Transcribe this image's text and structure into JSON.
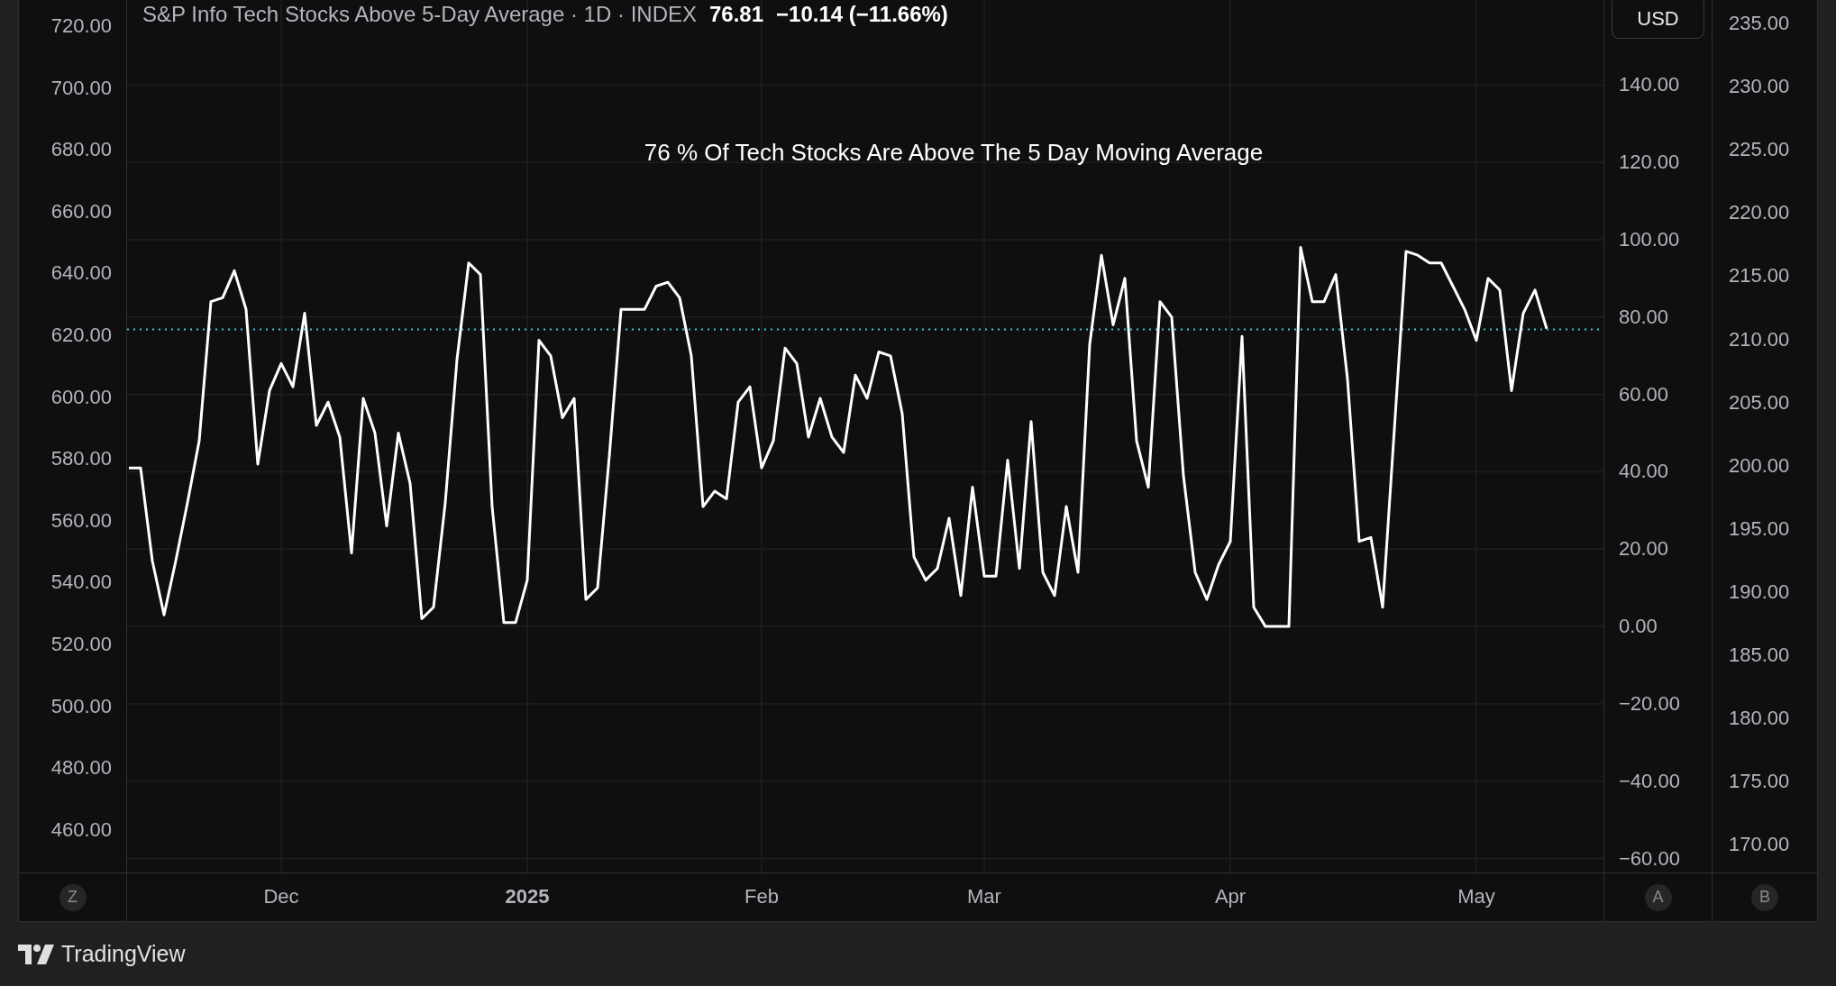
{
  "chart": {
    "header": {
      "title": "S&P Info Tech Stocks Above 5-Day Average · 1D · INDEX",
      "last": "76.81",
      "change": "−10.14 (−11.66%)"
    },
    "note": "76 % Of Tech Stocks Are Above The 5 Day Moving Average",
    "currency_button": "USD",
    "left_axis_labels": [
      "720.00",
      "700.00",
      "680.00",
      "660.00",
      "640.00",
      "620.00",
      "600.00",
      "580.00",
      "560.00",
      "540.00",
      "520.00",
      "500.00",
      "480.00",
      "460.00"
    ],
    "right_axis_labels": [
      "235.00",
      "230.00",
      "225.00",
      "220.00",
      "215.00",
      "210.00",
      "205.00",
      "200.00",
      "195.00",
      "190.00",
      "185.00",
      "180.00",
      "175.00",
      "170.00"
    ],
    "corner_buttons": [
      {
        "label": "Z"
      },
      {
        "label": "A"
      },
      {
        "label": "B"
      }
    ],
    "chart_data": {
      "type": "line",
      "ylim": [
        -63.6,
        162
      ],
      "yticks": [
        {
          "value": 140,
          "label": "140.00"
        },
        {
          "value": 120,
          "label": "120.00"
        },
        {
          "value": 100,
          "label": "100.00"
        },
        {
          "value": 80,
          "label": "80.00"
        },
        {
          "value": 60,
          "label": "60.00"
        },
        {
          "value": 40,
          "label": "40.00"
        },
        {
          "value": 20,
          "label": "20.00"
        },
        {
          "value": 0,
          "label": "0.00"
        },
        {
          "value": -20,
          "label": "−20.00"
        },
        {
          "value": -40,
          "label": "−40.00"
        },
        {
          "value": -60,
          "label": "−60.00"
        }
      ],
      "grid": true,
      "ref_lines": [
        {
          "axis": "y",
          "value": 76.81,
          "color": "#3fc8d8"
        }
      ],
      "categories": [
        null,
        null,
        null,
        null,
        null,
        null,
        null,
        null,
        null,
        null,
        null,
        null,
        null,
        "Dec",
        null,
        null,
        null,
        null,
        null,
        null,
        null,
        null,
        null,
        null,
        null,
        null,
        null,
        null,
        null,
        null,
        null,
        null,
        null,
        null,
        "2025",
        null,
        null,
        null,
        null,
        null,
        null,
        null,
        null,
        null,
        null,
        null,
        null,
        null,
        null,
        null,
        null,
        null,
        null,
        null,
        "Feb",
        null,
        null,
        null,
        null,
        null,
        null,
        null,
        null,
        null,
        null,
        null,
        null,
        null,
        null,
        null,
        null,
        null,
        null,
        "Mar",
        null,
        null,
        null,
        null,
        null,
        null,
        null,
        null,
        null,
        null,
        null,
        null,
        null,
        null,
        null,
        null,
        null,
        null,
        null,
        null,
        "Apr",
        null,
        null,
        null,
        null,
        null,
        null,
        null,
        null,
        null,
        null,
        null,
        null,
        null,
        null,
        null,
        null,
        null,
        null,
        null,
        null,
        "May",
        null,
        null,
        null,
        null,
        null,
        null
      ],
      "series": [
        {
          "color": "#ffffff",
          "values": [
            41,
            41,
            17,
            3,
            17,
            32,
            48,
            84,
            85,
            92,
            82,
            42,
            61,
            68,
            62,
            81,
            52,
            58,
            49,
            19,
            59,
            50,
            26,
            50,
            37,
            2,
            5,
            32,
            69,
            94,
            91,
            31,
            1,
            1,
            12,
            74,
            70,
            54,
            59,
            7,
            10,
            44,
            82,
            82,
            82,
            88,
            89,
            85,
            70,
            31,
            35,
            33,
            58,
            62,
            41,
            48,
            72,
            68,
            49,
            59,
            49,
            45,
            65,
            59,
            71,
            70,
            55,
            18,
            12,
            15,
            28,
            8,
            36,
            13,
            13,
            43,
            15,
            53,
            14,
            8,
            31,
            14,
            73,
            96,
            78,
            90,
            48,
            36,
            84,
            80,
            39,
            14,
            7,
            16,
            22,
            75,
            5,
            0,
            0,
            0,
            98,
            84,
            84,
            91,
            64,
            22,
            23,
            5,
            51,
            97,
            96,
            94,
            94,
            88,
            82,
            74,
            90,
            87,
            61,
            81,
            87,
            77
          ]
        }
      ]
    }
  },
  "footer": {
    "brand": "TradingView"
  }
}
